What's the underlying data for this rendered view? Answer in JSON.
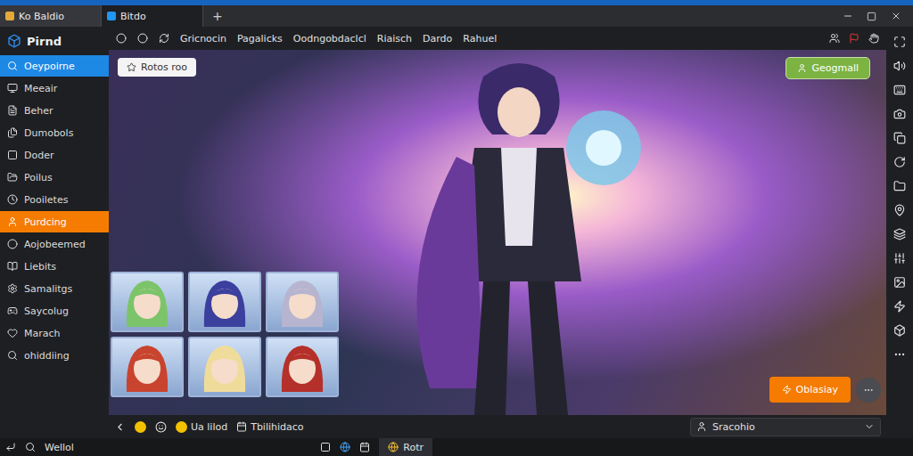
{
  "window": {
    "tabs": [
      {
        "label": "Ko Baldio",
        "selected": false
      },
      {
        "label": "Bitdo",
        "selected": true
      }
    ],
    "new_tab": "+"
  },
  "sidebar": {
    "title": "Pirnd",
    "items": [
      {
        "label": "Oeypoirne",
        "selected": true,
        "highlighted": false
      },
      {
        "label": "Meeair",
        "selected": false,
        "highlighted": false
      },
      {
        "label": "Beher",
        "selected": false,
        "highlighted": false
      },
      {
        "label": "Dumobols",
        "selected": false,
        "highlighted": false
      },
      {
        "label": "Doder",
        "selected": false,
        "highlighted": false
      },
      {
        "label": "Poilus",
        "selected": false,
        "highlighted": false
      },
      {
        "label": "Pooiletes",
        "selected": false,
        "highlighted": false
      },
      {
        "label": "Purdcing",
        "selected": false,
        "highlighted": true
      },
      {
        "label": "Aojobeemed",
        "selected": false,
        "highlighted": false
      },
      {
        "label": "Liebits",
        "selected": false,
        "highlighted": false
      },
      {
        "label": "Samalitgs",
        "selected": false,
        "highlighted": false
      },
      {
        "label": "Saycolug",
        "selected": false,
        "highlighted": false
      },
      {
        "label": "Marach",
        "selected": false,
        "highlighted": false
      },
      {
        "label": "ohiddiing",
        "selected": false,
        "highlighted": false
      }
    ]
  },
  "toolbar": {
    "links": [
      "Gricnocin",
      "Pagalicks",
      "Oodngobdaclcl",
      "Riaisch",
      "Dardo",
      "Rahuel"
    ]
  },
  "game": {
    "badge": "Rotos roo",
    "top_button": "Geogmall",
    "action_button": "Oblasiay",
    "characters": [
      {
        "color": "#7cc46a"
      },
      {
        "color": "#3b3f9e"
      },
      {
        "color": "#b7b4cf"
      },
      {
        "color": "#c8442e"
      },
      {
        "color": "#f0dc9a"
      },
      {
        "color": "#b5302a"
      }
    ]
  },
  "bottom_bar": {
    "links": [
      "Ua lilod",
      "Tbilihidaco"
    ],
    "account": "Sracohio"
  },
  "taskbar": {
    "search": "Wellol",
    "app": "Rotr"
  }
}
